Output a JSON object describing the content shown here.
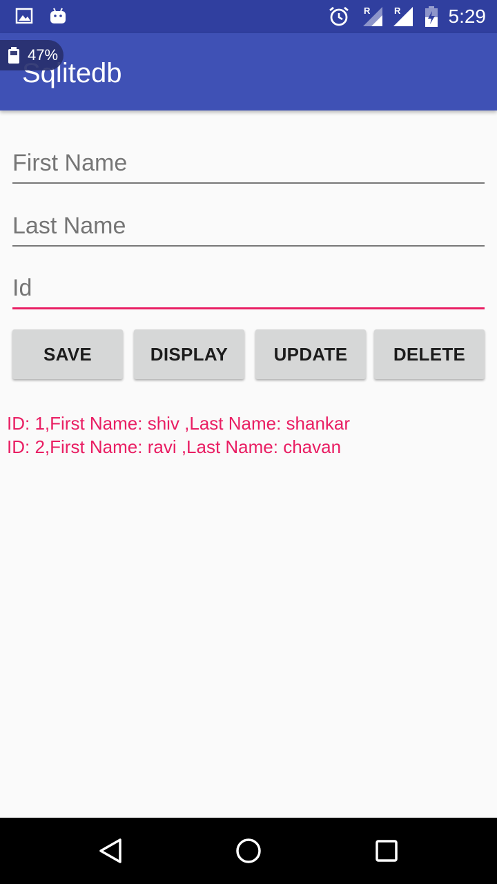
{
  "status_bar": {
    "time": "5:29",
    "left_icons": [
      "image-icon",
      "android-icon"
    ],
    "right_icons": [
      "alarm-icon",
      "signal-icon",
      "signal-icon",
      "battery-icon"
    ],
    "signal_labels": [
      "R",
      "R"
    ]
  },
  "battery_overlay": {
    "percent": "47%"
  },
  "app_bar": {
    "title": "Sqlitedb"
  },
  "form": {
    "first_name": {
      "value": "",
      "placeholder": "First Name"
    },
    "last_name": {
      "value": "",
      "placeholder": "Last Name"
    },
    "id": {
      "value": "",
      "placeholder": "Id",
      "focused": true
    }
  },
  "buttons": {
    "save": "SAVE",
    "display": "DISPLAY",
    "update": "UPDATE",
    "delete": "DELETE"
  },
  "output": {
    "lines": [
      "ID: 1,First Name: shiv ,Last Name: shankar",
      "ID: 2,First Name: ravi ,Last Name: chavan"
    ]
  },
  "colors": {
    "status_bar": "#303f9f",
    "app_bar": "#3f51b5",
    "accent": "#e91e63",
    "button": "#d6d7d7"
  }
}
